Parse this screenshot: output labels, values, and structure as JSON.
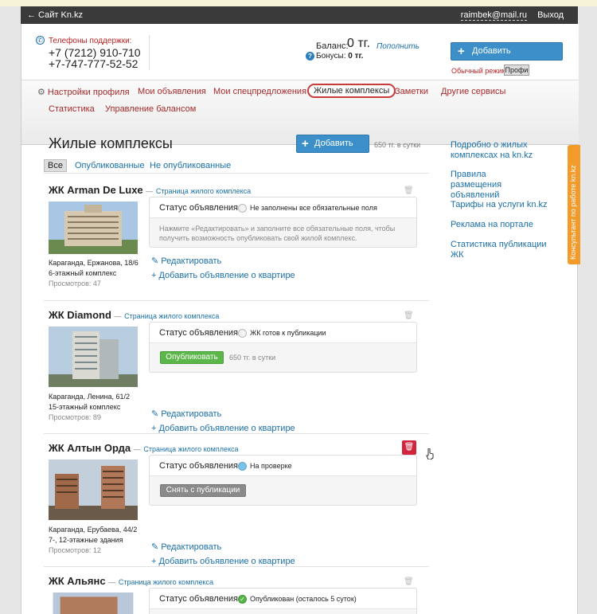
{
  "topbar": {
    "back_link": "← Сайт Kn.kz",
    "email": "raimbek@mail.ru",
    "logout": "Выход"
  },
  "header": {
    "support_label": "Телефоны поддержки:",
    "phone1": "+7 (7212) 910-710",
    "phone2": "+7-747-777-52-52",
    "balance_label": "Баланс:",
    "balance_value": "0 тг.",
    "balance_link": "Пополнить",
    "bonus_label": "Бонусы:",
    "bonus_value": "0 тг.",
    "add_ad_button": "Добавить объявление",
    "mode_label": "Обычный режим",
    "mode_button": "Профи"
  },
  "nav": {
    "items": [
      "Настройки профиля",
      "Мои объявления",
      "Мои спецпредложения",
      "Жилые комплексы",
      "Заметки",
      "Другие сервисы",
      "Статистика",
      "Управление балансом"
    ],
    "active_index": 3
  },
  "main": {
    "title": "Жилые комплексы",
    "add_button": "Добавить ЖК",
    "add_price": "650 тг. в сутки",
    "filters": [
      "Все",
      "Опубликованные",
      "Не опубликованные"
    ],
    "active_filter": 0
  },
  "common": {
    "page_link": "Страница жилого комплекса",
    "status_label": "Статус объявления:",
    "edit": "Редактировать",
    "add_flat": "Добавить объявление о квартире"
  },
  "complexes": [
    {
      "name": "ЖК Arman De Luxe",
      "address": "Караганда, Ержанова, 18/6",
      "kind": "6-этажный комплекс",
      "views": "Просмотров: 47",
      "status": "Не заполнены все обязательные поля",
      "hint": "Нажмите «Редактировать» и заполните все обязательные поля, чтобы получить возможность опубликовать свой жилой комплекс."
    },
    {
      "name": "ЖК Diamond",
      "address": "Караганда, Ленина, 61/2",
      "kind": "15-этажный комплекс",
      "views": "Просмотров: 89",
      "status": "ЖК готов к публикации",
      "action": "Опубликовать",
      "action_price": "650 тг. в сутки"
    },
    {
      "name": "ЖК Алтын Орда",
      "address": "Караганда, Ерубаева, 44/2",
      "kind": "7-, 12-этажные здания",
      "views": "Просмотров: 12",
      "status": "На проверке",
      "action": "Снять с публикации"
    },
    {
      "name": "ЖК Альянс",
      "status": "Опубликован (осталось 5 суток)"
    }
  ],
  "sidebar": {
    "links": [
      "Подробно о жилых комплексах на kn.kz",
      "Правила размещения объявлений",
      "Тарифы на услуги kn.kz",
      "Реклама на портале",
      "Статистика публикации ЖК"
    ]
  },
  "consultant": "Консультант по работе kn.kz",
  "colors": {
    "brand_blue": "#3d8fc9",
    "link": "#1a6fa8",
    "nav_text": "#a52a2a",
    "publish_green": "#5cb74a",
    "delete_red": "#d0253c",
    "consultant_orange": "#f29b2b"
  }
}
